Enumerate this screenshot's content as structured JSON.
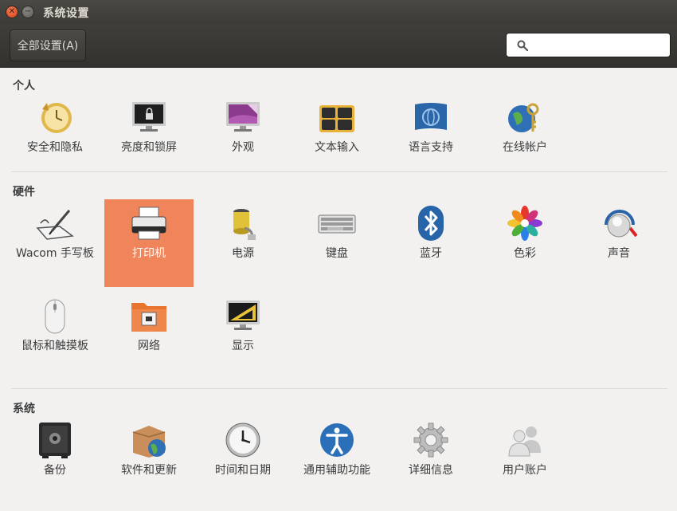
{
  "window": {
    "title": "系统设置"
  },
  "toolbar": {
    "all_settings_label": "全部设置(A)",
    "search_placeholder": ""
  },
  "sections": {
    "personal": {
      "title": "个人",
      "items": [
        {
          "label": "安全和隐私",
          "icon": "backup-clock-icon"
        },
        {
          "label": "亮度和锁屏",
          "icon": "lock-monitor-icon"
        },
        {
          "label": "外观",
          "icon": "appearance-monitor-icon"
        },
        {
          "label": "文本输入",
          "icon": "keyboard-input-icon"
        },
        {
          "label": "语言支持",
          "icon": "language-flag-icon"
        },
        {
          "label": "在线帐户",
          "icon": "online-accounts-icon"
        }
      ]
    },
    "hardware": {
      "title": "硬件",
      "items": [
        {
          "label": "Wacom 手写板",
          "icon": "wacom-tablet-icon"
        },
        {
          "label": "打印机",
          "icon": "printer-icon",
          "selected": true
        },
        {
          "label": "电源",
          "icon": "battery-power-icon"
        },
        {
          "label": "键盘",
          "icon": "keyboard-icon"
        },
        {
          "label": "蓝牙",
          "icon": "bluetooth-icon"
        },
        {
          "label": "色彩",
          "icon": "color-flower-icon"
        },
        {
          "label": "声音",
          "icon": "sound-knob-icon"
        },
        {
          "label": "鼠标和触摸板",
          "icon": "mouse-icon"
        },
        {
          "label": "网络",
          "icon": "network-folder-icon"
        },
        {
          "label": "显示",
          "icon": "display-monitor-icon"
        }
      ]
    },
    "system": {
      "title": "系统",
      "items": [
        {
          "label": "备份",
          "icon": "safe-backup-icon"
        },
        {
          "label": "软件和更新",
          "icon": "software-box-icon"
        },
        {
          "label": "时间和日期",
          "icon": "clock-icon"
        },
        {
          "label": "通用辅助功能",
          "icon": "accessibility-icon"
        },
        {
          "label": "详细信息",
          "icon": "gear-icon"
        },
        {
          "label": "用户账户",
          "icon": "users-icon"
        }
      ]
    }
  },
  "colors": {
    "selection": "#f0845a",
    "titlebar": "#3c3b37",
    "background": "#f2f1f0"
  }
}
